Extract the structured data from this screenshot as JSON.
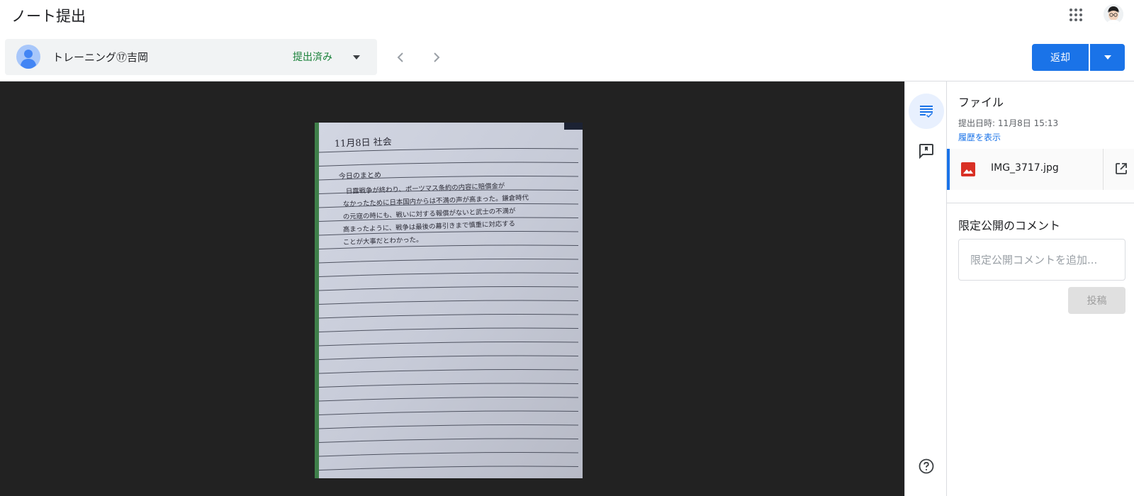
{
  "header": {
    "title": "ノート提出",
    "apps_icon": "apps-grid-icon",
    "profile_icon": "account-avatar"
  },
  "student": {
    "name": "トレーニング⑰吉岡",
    "status": "提出済み",
    "status_color": "#188038"
  },
  "actions": {
    "return_label": "返却"
  },
  "file_panel": {
    "heading": "ファイル",
    "submitted_at": "提出日時: 11月8日 15:13",
    "history_link": "履歴を表示",
    "file_name": "IMG_3717.jpg"
  },
  "comments": {
    "heading": "限定公開のコメント",
    "placeholder": "限定公開コメントを追加...",
    "post_label": "投稿"
  },
  "note_image": {
    "lines": [
      "11月8日 社会",
      "今日のまとめ",
      "日露戦争が終わり、ポーツマス条約の内容に賠償金が",
      "なかったために日本国内からは不満の声が高まった。鎌倉時代",
      "の元寇の時にも、戦いに対する報償がないと武士の不満が",
      "高まったように、戦争は最後の幕引きまで慎重に対応する",
      "ことが大事だとわかった。"
    ]
  },
  "colors": {
    "accent": "#1a73e8",
    "viewer_background": "#222222"
  }
}
